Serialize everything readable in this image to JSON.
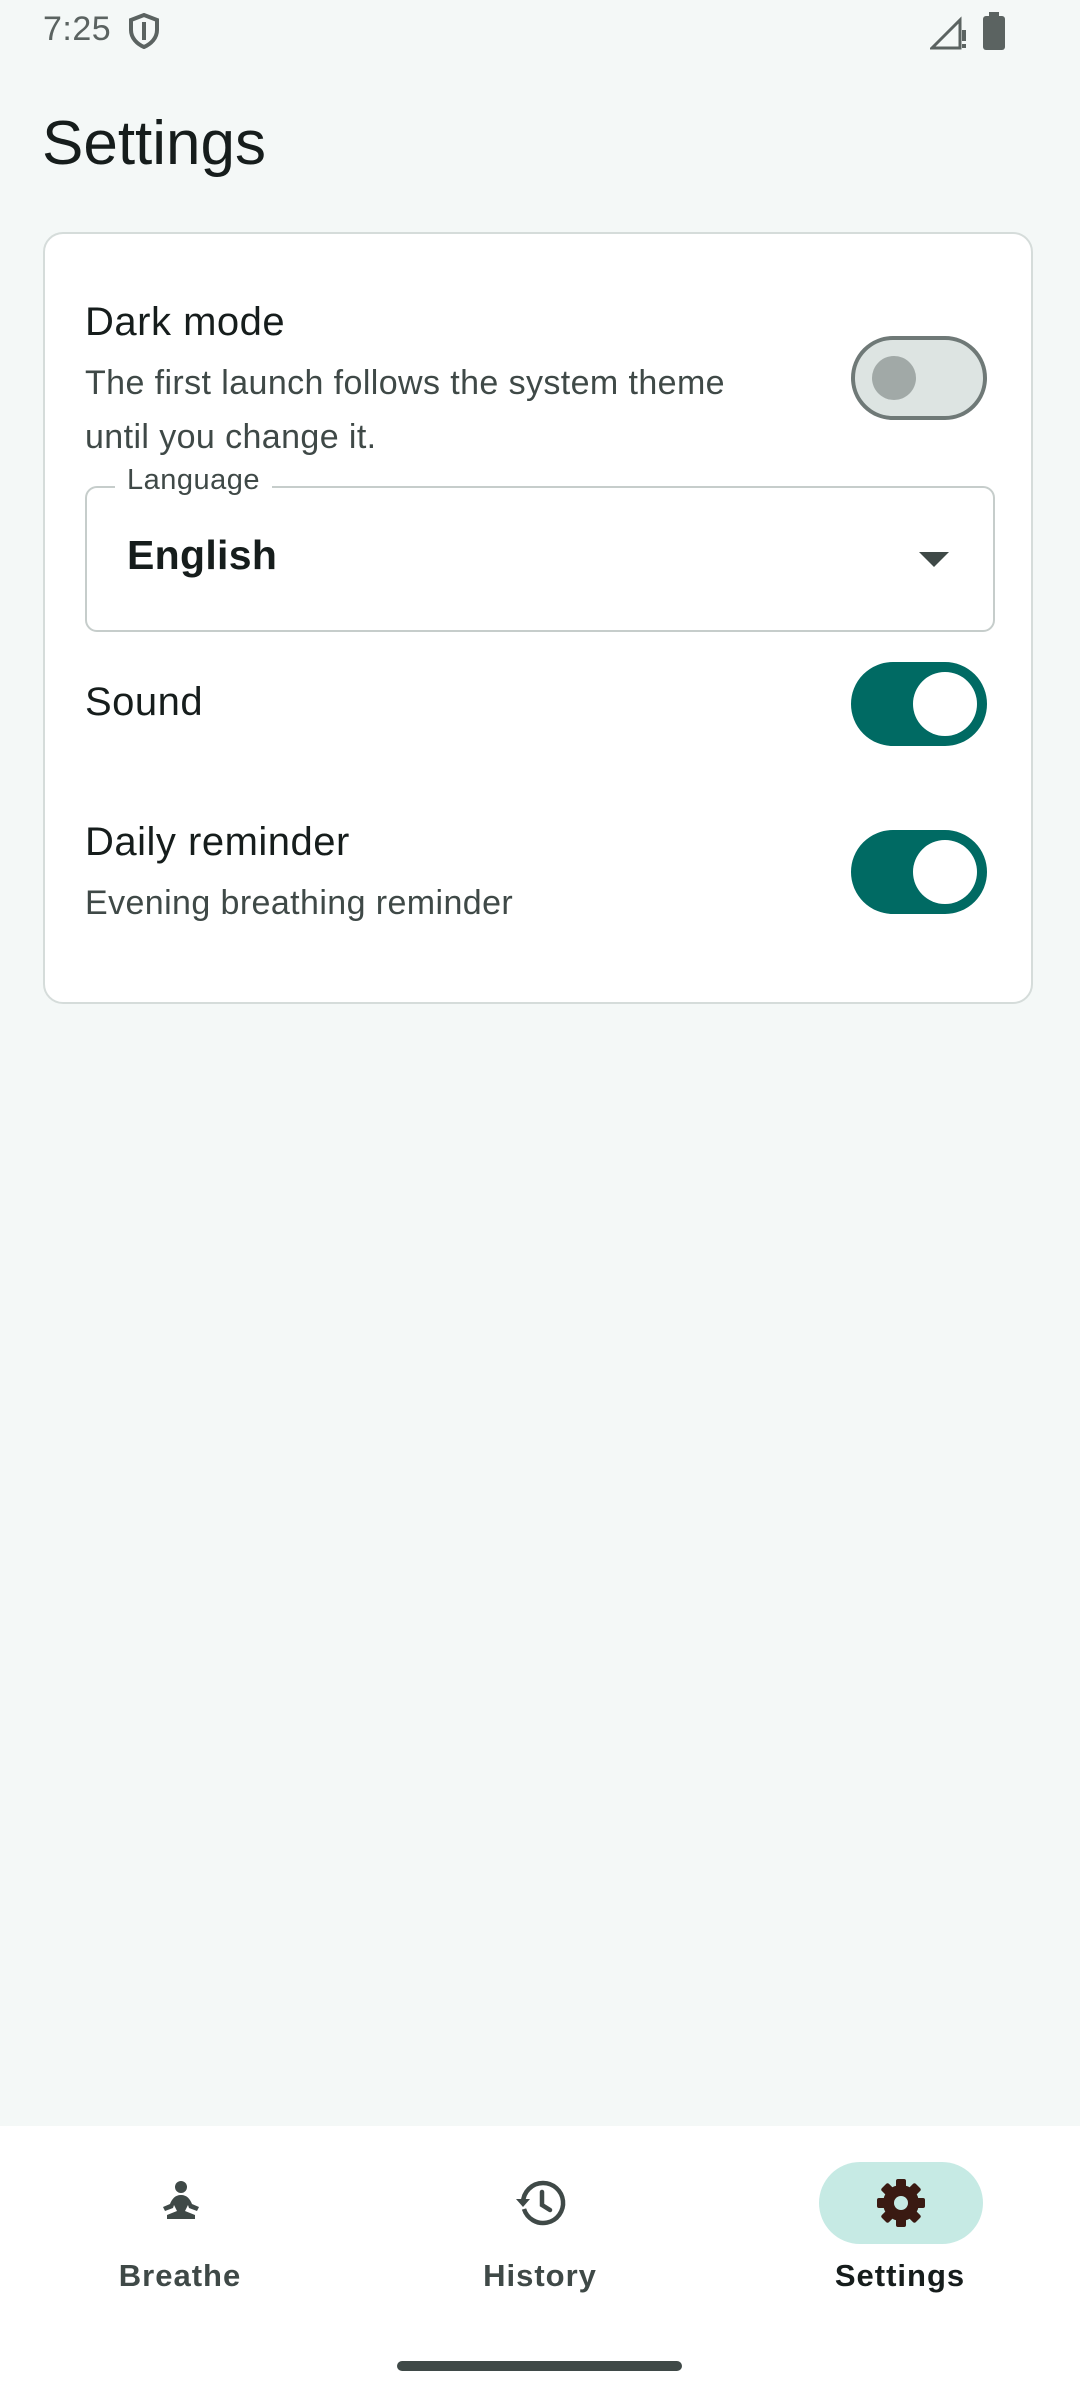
{
  "status_bar": {
    "time": "7:25",
    "icons": [
      "shield-icon",
      "signal-icon",
      "battery-icon"
    ]
  },
  "page": {
    "title": "Settings"
  },
  "settings": {
    "dark_mode": {
      "title": "Dark mode",
      "subtitle_line1": "The first launch follows the system theme",
      "subtitle_line2": "until you change it.",
      "enabled": false
    },
    "language": {
      "label": "Language",
      "value": "English"
    },
    "sound": {
      "title": "Sound",
      "enabled": true
    },
    "daily_reminder": {
      "title": "Daily reminder",
      "subtitle": "Evening breathing reminder",
      "enabled": true
    }
  },
  "bottom_nav": {
    "items": [
      {
        "label": "Breathe",
        "icon": "meditation-icon",
        "active": false
      },
      {
        "label": "History",
        "icon": "history-icon",
        "active": false
      },
      {
        "label": "Settings",
        "icon": "gear-icon",
        "active": true
      }
    ]
  },
  "colors": {
    "primary": "#006a63",
    "background": "#f4f8f7",
    "active_indicator": "#c6eae4",
    "on_surface": "#161d1c",
    "on_surface_variant": "#3f4947"
  }
}
